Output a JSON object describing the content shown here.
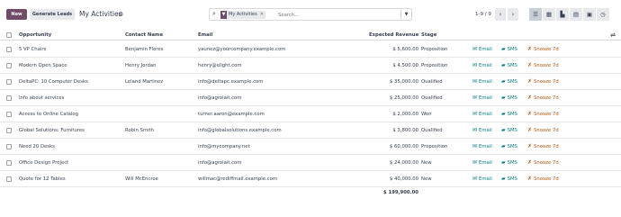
{
  "controls": {
    "new_label": "New",
    "generate_label": "Generate Leads",
    "title": "My Activities",
    "search_facet": "My Activities",
    "search_placeholder": "Search...",
    "pager_text": "1-9 / 9"
  },
  "table": {
    "headers": {
      "opportunity": "Opportunity",
      "contact": "Contact Name",
      "email": "Email",
      "revenue": "Expected Revenue",
      "stage": "Stage"
    },
    "actions": {
      "email": "Email",
      "sms": "SMS",
      "snooze": "Snooze 7d"
    },
    "rows": [
      {
        "opportunity": "5 VP Chairs",
        "contact": "Benjamin Flores",
        "email": "yaunez@yourcompany.example.com",
        "revenue": "$ 5,600.00",
        "stage": "Proposition"
      },
      {
        "opportunity": "Modern Open Space",
        "contact": "Henry Jordan",
        "email": "henry@elight.com",
        "revenue": "$ 4,500.00",
        "stage": "Proposition"
      },
      {
        "opportunity": "DeltaPC: 10 Computer Desks",
        "contact": "Leland Martinez",
        "email": "info@deltapc.example.com",
        "revenue": "$ 35,000.00",
        "stage": "Qualified"
      },
      {
        "opportunity": "Info about services",
        "contact": "",
        "email": "info@agrolait.com",
        "revenue": "$ 25,000.00",
        "stage": "Qualified"
      },
      {
        "opportunity": "Access to Online Catalog",
        "contact": "",
        "email": "turner.aaron@example.com",
        "revenue": "$ 2,000.00",
        "stage": "Won"
      },
      {
        "opportunity": "Global Solutions: Furnitures",
        "contact": "Robin Smith",
        "email": "info@globalsolutions.example.com",
        "revenue": "$ 3,800.00",
        "stage": "Qualified"
      },
      {
        "opportunity": "Need 20 Desks",
        "contact": "",
        "email": "info@mycompany.net",
        "revenue": "$ 60,000.00",
        "stage": "Proposition"
      },
      {
        "opportunity": "Office Design Project",
        "contact": "",
        "email": "info@agrolait.com",
        "revenue": "$ 24,000.00",
        "stage": "New"
      },
      {
        "opportunity": "Quote for 12 Tables",
        "contact": "Will McEncroe",
        "email": "willmac@rediffmail.example.com",
        "revenue": "$ 40,000.00",
        "stage": "New"
      }
    ],
    "total": "$ 199,900.00"
  }
}
